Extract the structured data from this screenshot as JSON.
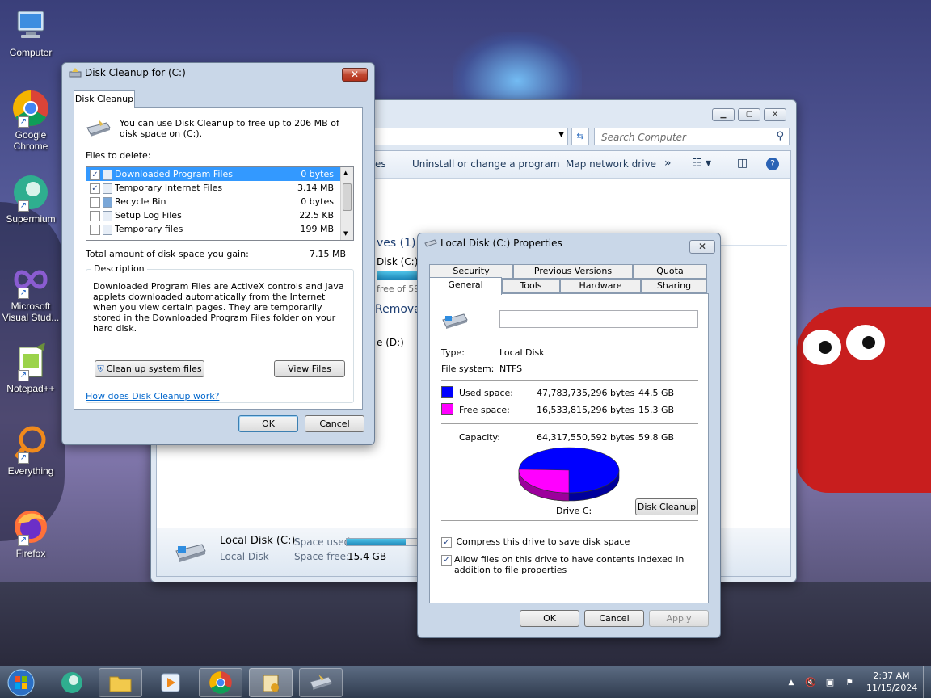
{
  "desktop": {
    "icons": [
      {
        "label": "Computer",
        "icon": "computer-icon"
      },
      {
        "label": "Google Chrome",
        "icon": "chrome-icon"
      },
      {
        "label": "Supermium",
        "icon": "supermium-icon"
      },
      {
        "label": "Microsoft Visual Stud...",
        "icon": "vscode-icon"
      },
      {
        "label": "Notepad++",
        "icon": "notepadpp-icon"
      },
      {
        "label": "Everything",
        "icon": "everything-icon"
      },
      {
        "label": "Firefox",
        "icon": "firefox-icon"
      }
    ]
  },
  "explorer": {
    "search_placeholder": "Search Computer",
    "toolbar": {
      "properties_partial": "ties",
      "uninstall": "Uninstall or change a program",
      "map_network": "Map network drive",
      "more": "»"
    },
    "section_hdd": "ves (1)",
    "disk_c_partial": "Disk (C:)",
    "disk_c_free_partial": "free of 59",
    "section_removable": "Remova",
    "drive_d_partial": "e (D:)",
    "details": {
      "name": "Local Disk (C:)",
      "type": "Local Disk",
      "space_used_label": "Space used:",
      "space_free_label": "Space free:",
      "space_free_value": "15.4 GB",
      "used_fraction": 0.74
    }
  },
  "cleanup": {
    "title": "Disk Cleanup for  (C:)",
    "tab": "Disk Cleanup",
    "intro": "You can use Disk Cleanup to free up to 206 MB of disk space on  (C:).",
    "files_label": "Files to delete:",
    "files": [
      {
        "name": "Downloaded Program Files",
        "size": "0 bytes",
        "checked": true,
        "selected": true
      },
      {
        "name": "Temporary Internet Files",
        "size": "3.14 MB",
        "checked": true,
        "selected": false
      },
      {
        "name": "Recycle Bin",
        "size": "0 bytes",
        "checked": false,
        "selected": false
      },
      {
        "name": "Setup Log Files",
        "size": "22.5 KB",
        "checked": false,
        "selected": false
      },
      {
        "name": "Temporary files",
        "size": "199 MB",
        "checked": false,
        "selected": false
      }
    ],
    "total_label": "Total amount of disk space you gain:",
    "total_value": "7.15 MB",
    "description_label": "Description",
    "description": "Downloaded Program Files are ActiveX controls and Java applets downloaded automatically from the Internet when you view certain pages. They are temporarily stored in the Downloaded Program Files folder on your hard disk.",
    "cleanup_system": "Clean up system files",
    "view_files": "View Files",
    "help_link": "How does Disk Cleanup work?",
    "ok": "OK",
    "cancel": "Cancel"
  },
  "props": {
    "title": "Local Disk (C:) Properties",
    "tabs_top": [
      "Security",
      "Previous Versions",
      "Quota"
    ],
    "tabs_bottom": [
      "General",
      "Tools",
      "Hardware",
      "Sharing"
    ],
    "name_value": "",
    "type_label": "Type:",
    "type_value": "Local Disk",
    "fs_label": "File system:",
    "fs_value": "NTFS",
    "used_label": "Used space:",
    "used_bytes": "47,783,735,296 bytes",
    "used_gb": "44.5 GB",
    "free_label": "Free space:",
    "free_bytes": "16,533,815,296 bytes",
    "free_gb": "15.3 GB",
    "capacity_label": "Capacity:",
    "capacity_bytes": "64,317,550,592 bytes",
    "capacity_gb": "59.8 GB",
    "drive_label": "Drive C:",
    "disk_cleanup": "Disk Cleanup",
    "compress": "Compress this drive to save disk space",
    "index": "Allow files on this drive to have contents indexed in addition to file properties",
    "compress_checked": true,
    "index_checked": true,
    "ok": "OK",
    "cancel": "Cancel",
    "apply": "Apply",
    "used_color": "#0000ff",
    "free_color": "#ff00ff",
    "used_fraction": 0.743
  },
  "taskbar": {
    "time": "2:37 AM",
    "date": "11/15/2024"
  }
}
